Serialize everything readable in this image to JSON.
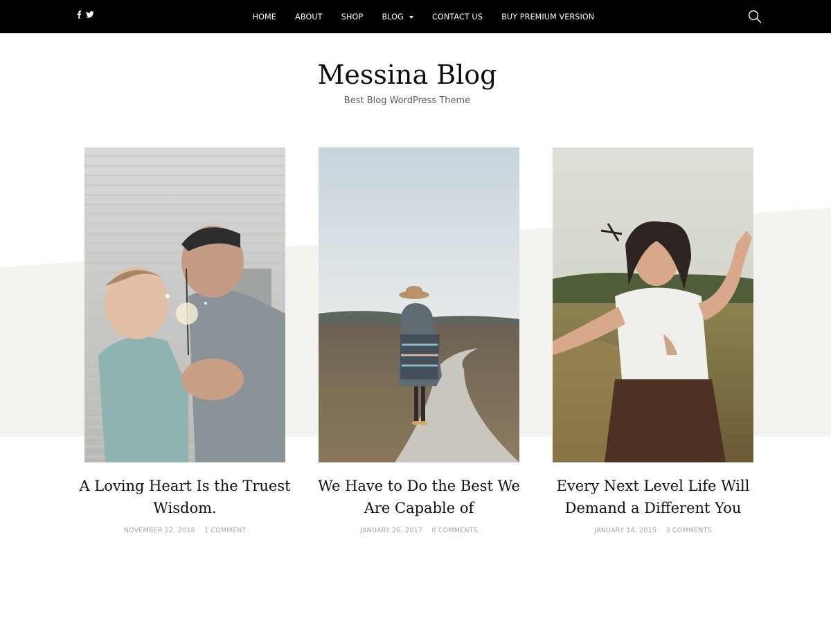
{
  "social": {
    "icons": [
      "facebook-icon",
      "twitter-icon"
    ]
  },
  "nav": {
    "items": [
      {
        "label": "HOME"
      },
      {
        "label": "ABOUT"
      },
      {
        "label": "SHOP"
      },
      {
        "label": "BLOG",
        "has_dropdown": true
      },
      {
        "label": "CONTACT US"
      },
      {
        "label": "BUY PREMIUM VERSION"
      }
    ],
    "search_icon": "search-icon"
  },
  "site": {
    "title": "Messina Blog",
    "tagline": "Best Blog WordPress Theme"
  },
  "colors": {
    "topbar": "#000000",
    "band": "#f5f3ef",
    "meta": "#a7a7a7"
  },
  "posts": [
    {
      "title": "A Loving Heart Is the Truest Wisdom.",
      "date": "NOVEMBER 22, 2018",
      "comments": "1 COMMENT"
    },
    {
      "title": "We Have to Do the Best We Are Capable of",
      "date": "JANUARY 26, 2017",
      "comments": "0 COMMENTS"
    },
    {
      "title": "Every Next Level Life Will Demand a Different You",
      "date": "JANUARY 14, 2015",
      "comments": "3 COMMENTS"
    }
  ]
}
